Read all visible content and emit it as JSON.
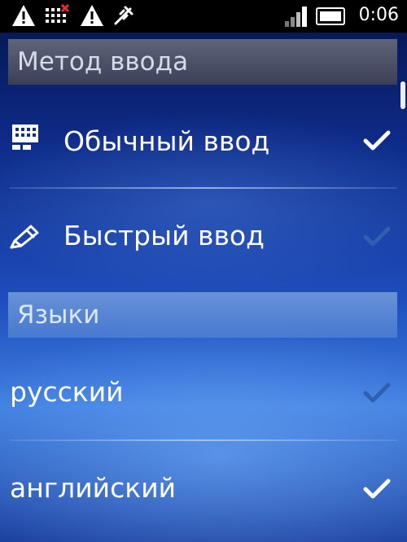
{
  "status_bar": {
    "time": "0:06",
    "icons": [
      "warning-icon",
      "network-error-icon",
      "warning-icon",
      "usb-debug-icon",
      "signal-icon",
      "battery-icon"
    ]
  },
  "method_section": {
    "title": "Метод ввода",
    "options": [
      {
        "label": "Обычный ввод",
        "icon": "keypad-icon",
        "checked": true
      },
      {
        "label": "Быстрый ввод",
        "icon": "pen-icon",
        "checked": false
      }
    ]
  },
  "languages_section": {
    "title": "Языки",
    "options": [
      {
        "label": "русский",
        "checked": false
      },
      {
        "label": "английский",
        "checked": true
      }
    ]
  },
  "colors": {
    "checked": "#ffffff",
    "unchecked": "#2f5fae"
  }
}
